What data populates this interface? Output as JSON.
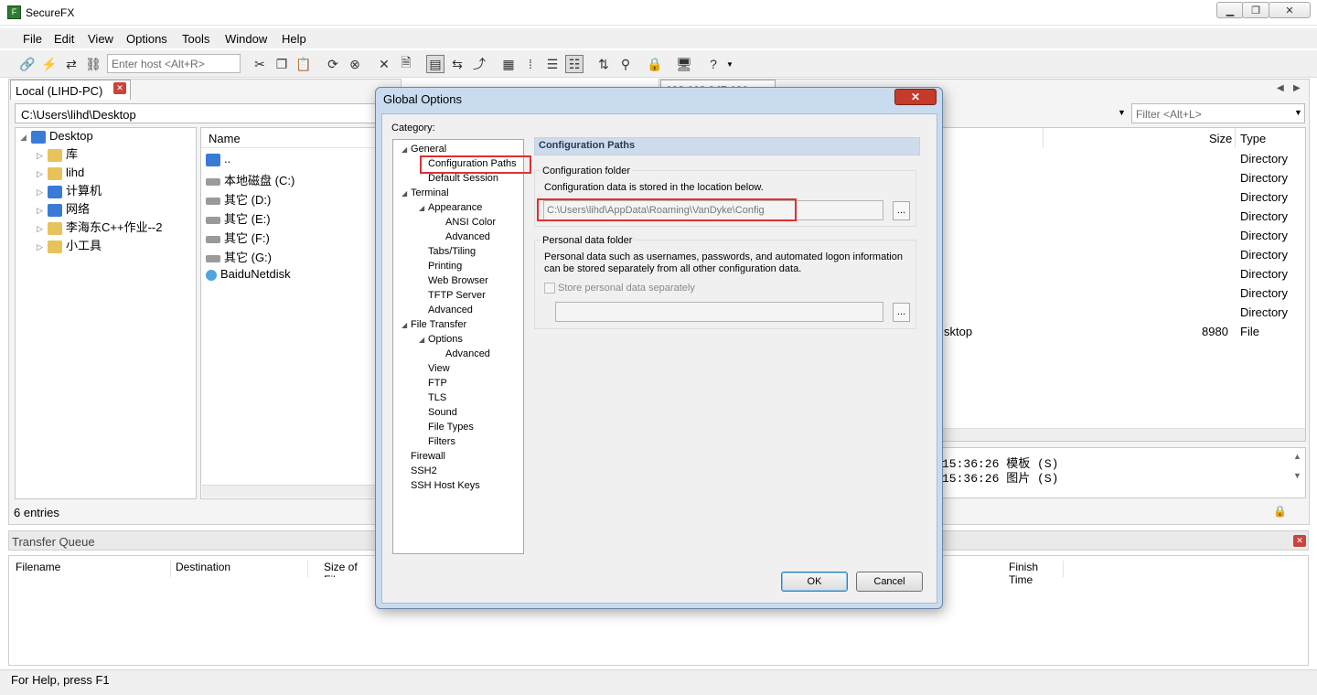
{
  "app": {
    "title": "SecureFX",
    "minimize": "▁",
    "restore": "❐",
    "close": "✕"
  },
  "menu": [
    "File",
    "Edit",
    "View",
    "Options",
    "Tools",
    "Window",
    "Help"
  ],
  "toolbar": {
    "host_placeholder": "Enter host <Alt+R>"
  },
  "local": {
    "tab": "Local (LIHD-PC)",
    "path": "C:\\Users\\lihd\\Desktop",
    "tree": [
      {
        "label": "Desktop",
        "level": 0,
        "icon": "desktop-icon"
      },
      {
        "label": "库",
        "level": 1,
        "icon": "library-icon"
      },
      {
        "label": "lihd",
        "level": 1,
        "icon": "user-folder-icon"
      },
      {
        "label": "计算机",
        "level": 1,
        "icon": "computer-icon"
      },
      {
        "label": "网络",
        "level": 1,
        "icon": "network-icon"
      },
      {
        "label": "李海东C++作业--2",
        "level": 1,
        "icon": "folder-icon"
      },
      {
        "label": "小工具",
        "level": 1,
        "icon": "folder-icon"
      }
    ],
    "name_header": "Name",
    "files": [
      "..",
      "本地磁盘 (C:)",
      "其它 (D:)",
      "其它 (E:)",
      "其它 (F:)",
      "其它 (G:)",
      "BaiduNetdisk"
    ],
    "status": "6 entries"
  },
  "remote": {
    "tab": "192.168.247.130",
    "filter_placeholder": "Filter <Alt+L>",
    "size_header": "Size",
    "type_header": "Type",
    "types": [
      "Directory",
      "Directory",
      "Directory",
      "Directory",
      "Directory",
      "Directory",
      "Directory",
      "Directory",
      "Directory",
      "File"
    ],
    "desktop_frag": "sktop",
    "desktop_size": "8980",
    "log": [
      "15:36:26 模板 (S)",
      "15:36:26 图片 (S)"
    ]
  },
  "queue": {
    "title": "Transfer Queue",
    "headers": [
      "Filename",
      "Destination",
      "Size of File",
      "Finish Time"
    ]
  },
  "status": "For Help, press F1",
  "dialog": {
    "title": "Global Options",
    "category_label": "Category:",
    "categories": [
      {
        "label": "General",
        "level": 0,
        "arrow": "◢"
      },
      {
        "label": "Configuration Paths",
        "level": 1,
        "arrow": ""
      },
      {
        "label": "Default Session",
        "level": 1,
        "arrow": ""
      },
      {
        "label": "Terminal",
        "level": 0,
        "arrow": "◢"
      },
      {
        "label": "Appearance",
        "level": 1,
        "arrow": "◢"
      },
      {
        "label": "ANSI Color",
        "level": 2,
        "arrow": ""
      },
      {
        "label": "Advanced",
        "level": 2,
        "arrow": ""
      },
      {
        "label": "Tabs/Tiling",
        "level": 1,
        "arrow": ""
      },
      {
        "label": "Printing",
        "level": 1,
        "arrow": ""
      },
      {
        "label": "Web Browser",
        "level": 1,
        "arrow": ""
      },
      {
        "label": "TFTP Server",
        "level": 1,
        "arrow": ""
      },
      {
        "label": "Advanced",
        "level": 1,
        "arrow": ""
      },
      {
        "label": "File Transfer",
        "level": 0,
        "arrow": "◢"
      },
      {
        "label": "Options",
        "level": 1,
        "arrow": "◢"
      },
      {
        "label": "Advanced",
        "level": 2,
        "arrow": ""
      },
      {
        "label": "View",
        "level": 1,
        "arrow": ""
      },
      {
        "label": "FTP",
        "level": 1,
        "arrow": ""
      },
      {
        "label": "TLS",
        "level": 1,
        "arrow": ""
      },
      {
        "label": "Sound",
        "level": 1,
        "arrow": ""
      },
      {
        "label": "File Types",
        "level": 1,
        "arrow": ""
      },
      {
        "label": "Filters",
        "level": 1,
        "arrow": ""
      },
      {
        "label": "Firewall",
        "level": 0,
        "arrow": ""
      },
      {
        "label": "SSH2",
        "level": 0,
        "arrow": ""
      },
      {
        "label": "SSH Host Keys",
        "level": 0,
        "arrow": ""
      }
    ],
    "panel_title": "Configuration Paths",
    "config_group": "Configuration folder",
    "config_desc": "Configuration data is stored in the location below.",
    "config_path": "C:\\Users\\lihd\\AppData\\Roaming\\VanDyke\\Config",
    "personal_group": "Personal data folder",
    "personal_desc1": "Personal data such as usernames, passwords, and automated logon information",
    "personal_desc2": "can be stored separately from all other configuration data.",
    "store_label": "Store personal data separately",
    "store_checked": false,
    "browse": "...",
    "ok": "OK",
    "cancel": "Cancel"
  },
  "colors": {
    "highlight": "#e03030",
    "dialog_frame": "#c9dbee",
    "panel_header": "#cddbea"
  }
}
